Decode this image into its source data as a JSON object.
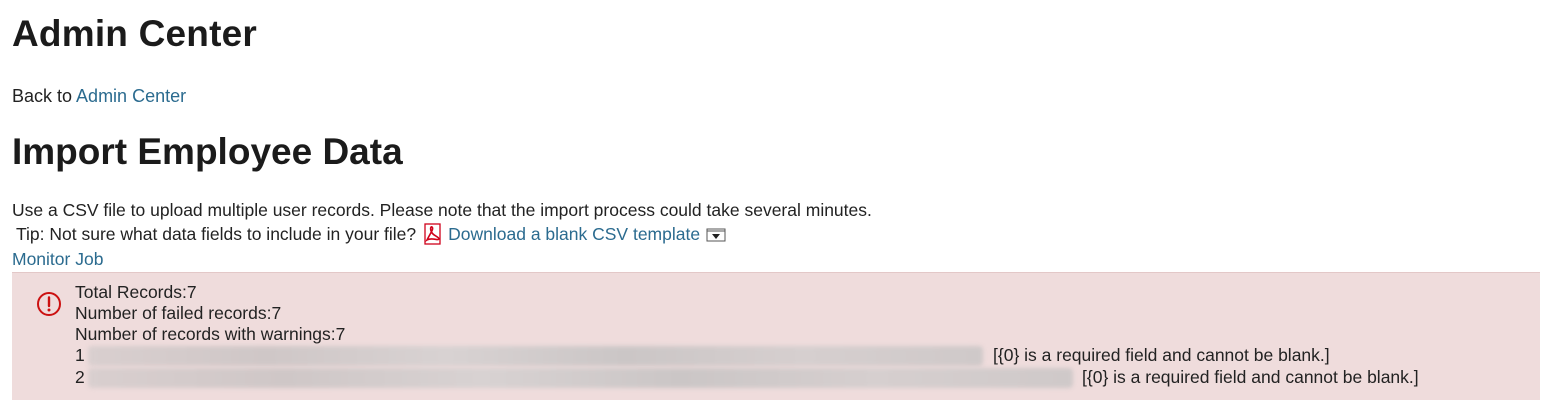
{
  "header": {
    "title": "Admin Center",
    "back_prefix": "Back to",
    "back_link": "Admin Center"
  },
  "main": {
    "title": "Import Employee Data",
    "description": "Use a CSV file to upload multiple user records. Please note that the import process could take several minutes.",
    "tip_text": "Tip: Not sure what data fields to include in your file?",
    "template_link": "Download a blank CSV template",
    "monitor_link": "Monitor Job"
  },
  "alert": {
    "icon": "error-circle-icon",
    "color": "#efdcdc",
    "icon_color": "#cc1111",
    "lines": [
      "Total Records:7",
      "Number of failed records:7",
      "Number of records with warnings:7"
    ],
    "rows": [
      {
        "num": "1",
        "message": "[{0} is a required field and cannot be blank.]"
      },
      {
        "num": "2",
        "message": "[{0} is a required field and cannot be blank.]"
      }
    ]
  },
  "colors": {
    "link": "#2b6b8f",
    "pdf_icon": "#d0021b"
  }
}
